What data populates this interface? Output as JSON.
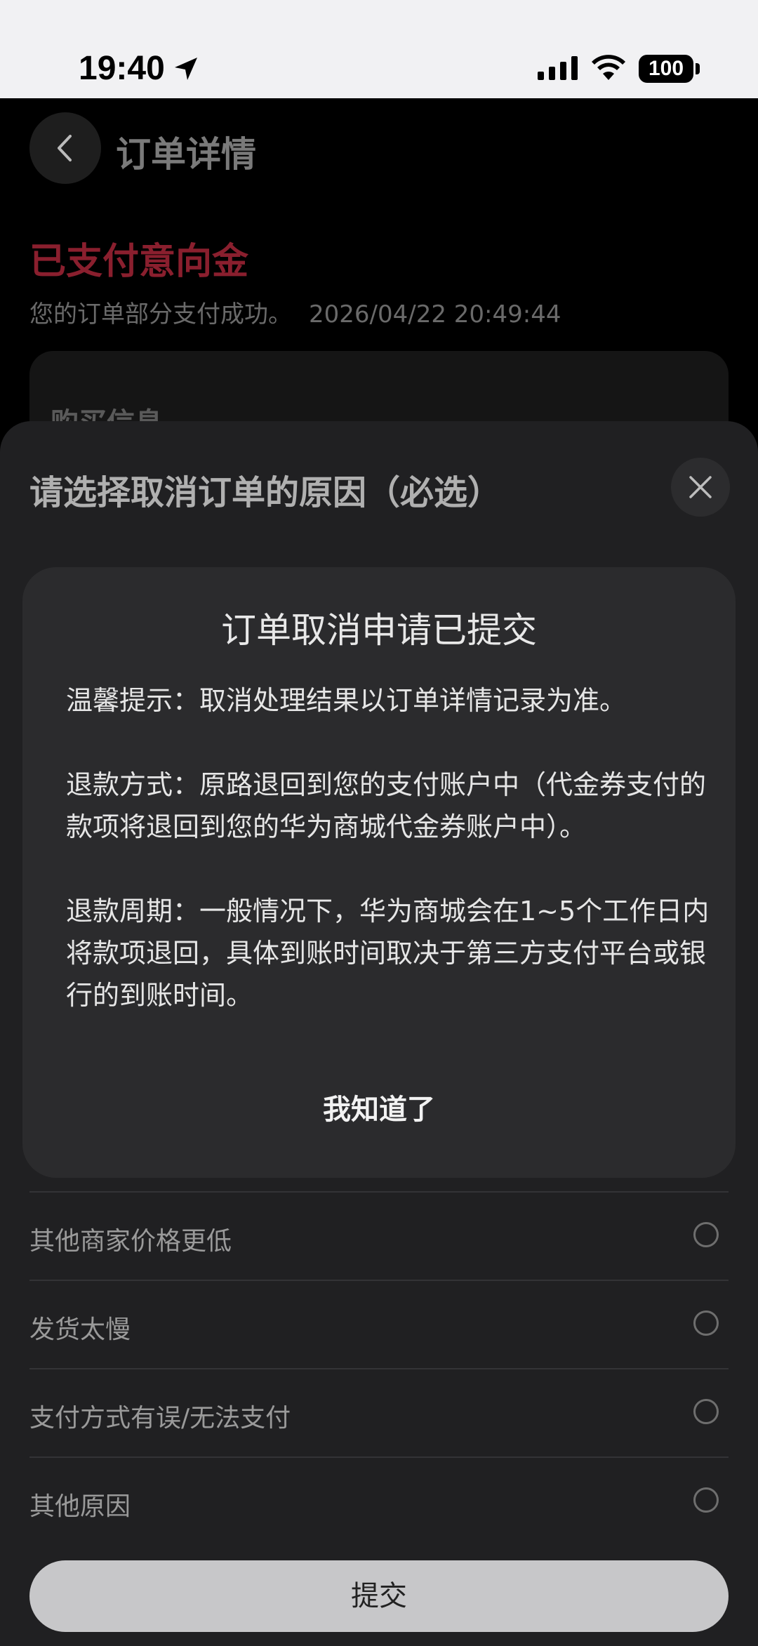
{
  "status_bar": {
    "time": "19:40",
    "battery": "100",
    "icons": [
      "location-arrow-icon",
      "cellular-signal-icon",
      "wifi-icon",
      "battery-icon"
    ]
  },
  "page": {
    "title": "订单详情",
    "order_status": "已支付意向金",
    "order_message": "您的订单部分支付成功。",
    "order_time": "2026/04/22 20:49:44",
    "purchase_card_title": "购买信息"
  },
  "sheet": {
    "title": "请选择取消订单的原因（必选）",
    "reasons": [
      {
        "label": "其他商家价格更低"
      },
      {
        "label": "发货太慢"
      },
      {
        "label": "支付方式有误/无法支付"
      },
      {
        "label": "其他原因"
      }
    ],
    "submit_label": "提交"
  },
  "dialog": {
    "title": "订单取消申请已提交",
    "tip": "温馨提示：取消处理结果以订单详情记录为准。",
    "refund_method": "退款方式：原路退回到您的支付账户中（代金券支付的款项将退回到您的华为商城代金券账户中）。",
    "refund_period": "退款周期：一般情况下，华为商城会在1~5个工作日内将款项退回，具体到账时间取决于第三方支付平台或银行的到账时间。",
    "confirm_label": "我知道了"
  },
  "colors": {
    "status_red": "#8a1f2e",
    "sheet_bg": "#202022",
    "dialog_bg": "#2b2b2d",
    "submit_bg": "#c7c7c9"
  }
}
